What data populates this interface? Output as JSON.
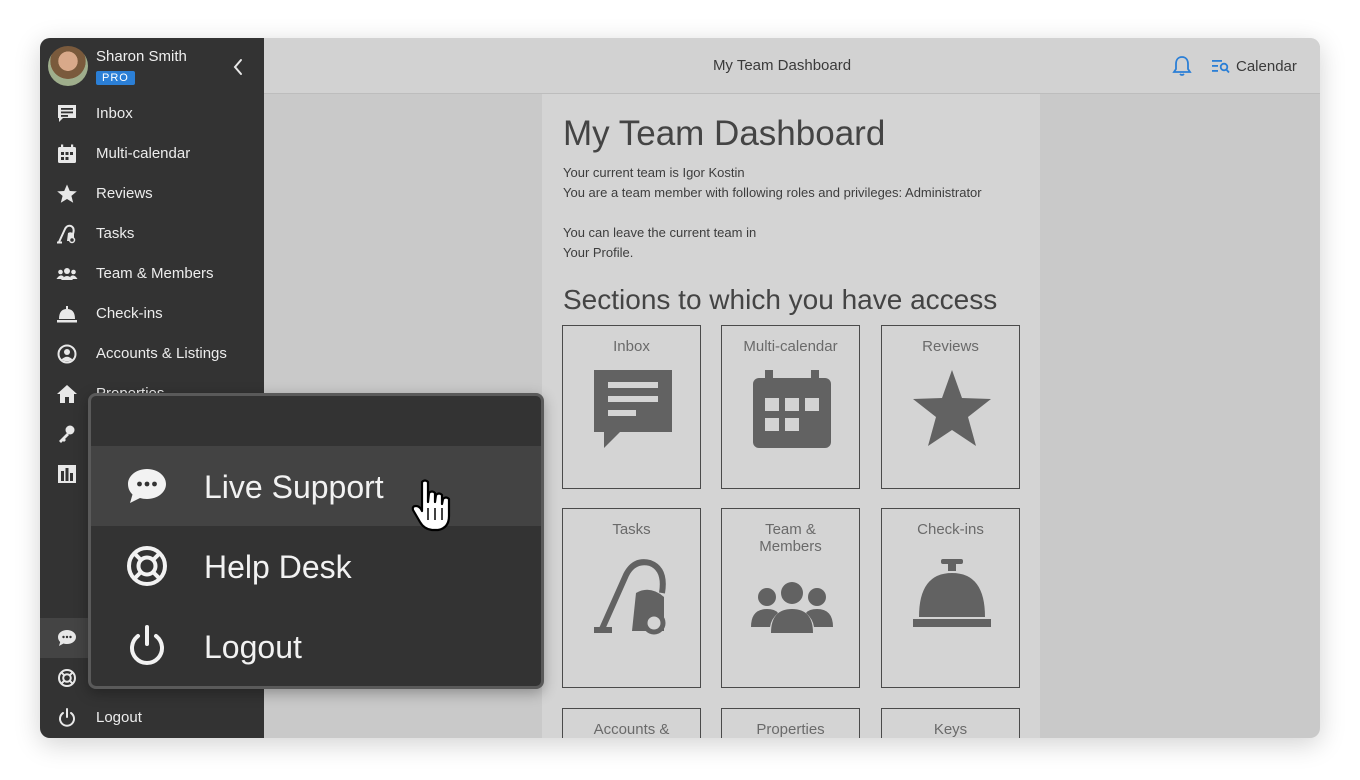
{
  "sidebar": {
    "user_name": "Sharon Smith",
    "badge": "PRO",
    "items": [
      {
        "label": "Inbox",
        "icon": "inbox-icon"
      },
      {
        "label": "Multi-calendar",
        "icon": "calendar-icon"
      },
      {
        "label": "Reviews",
        "icon": "star-icon"
      },
      {
        "label": "Tasks",
        "icon": "vacuum-icon"
      },
      {
        "label": "Team & Members",
        "icon": "team-icon"
      },
      {
        "label": "Check-ins",
        "icon": "bell-desk-icon"
      },
      {
        "label": "Accounts & Listings",
        "icon": "account-icon"
      },
      {
        "label": "Properties",
        "icon": "home-icon"
      }
    ],
    "bottom_items": [
      {
        "label": "Logout",
        "icon": "power-icon"
      }
    ]
  },
  "topbar": {
    "title": "My Team Dashboard",
    "calendar_label": "Calendar"
  },
  "main": {
    "heading": "My Team Dashboard",
    "line1": "Your current team is Igor Kostin",
    "line2": "You are a team member with following roles and privileges: Administrator",
    "line3": "You can leave the current team in",
    "line4": "Your Profile.",
    "sections_heading": "Sections to which you have access",
    "cards": [
      {
        "label": "Inbox"
      },
      {
        "label": "Multi-calendar"
      },
      {
        "label": "Reviews"
      },
      {
        "label": "Tasks"
      },
      {
        "label": "Team &\nMembers"
      },
      {
        "label": "Check-ins"
      },
      {
        "label": "Accounts &"
      },
      {
        "label": "Properties"
      },
      {
        "label": "Keys"
      }
    ]
  },
  "popup": {
    "items": [
      {
        "label": "Live Support",
        "icon": "chat-bubble-icon"
      },
      {
        "label": "Help Desk",
        "icon": "lifebuoy-icon"
      },
      {
        "label": "Logout",
        "icon": "power-icon"
      }
    ]
  },
  "colors": {
    "sidebar_bg": "#333333",
    "accent": "#2b7fd6",
    "content_bg": "#d4d4d4"
  }
}
